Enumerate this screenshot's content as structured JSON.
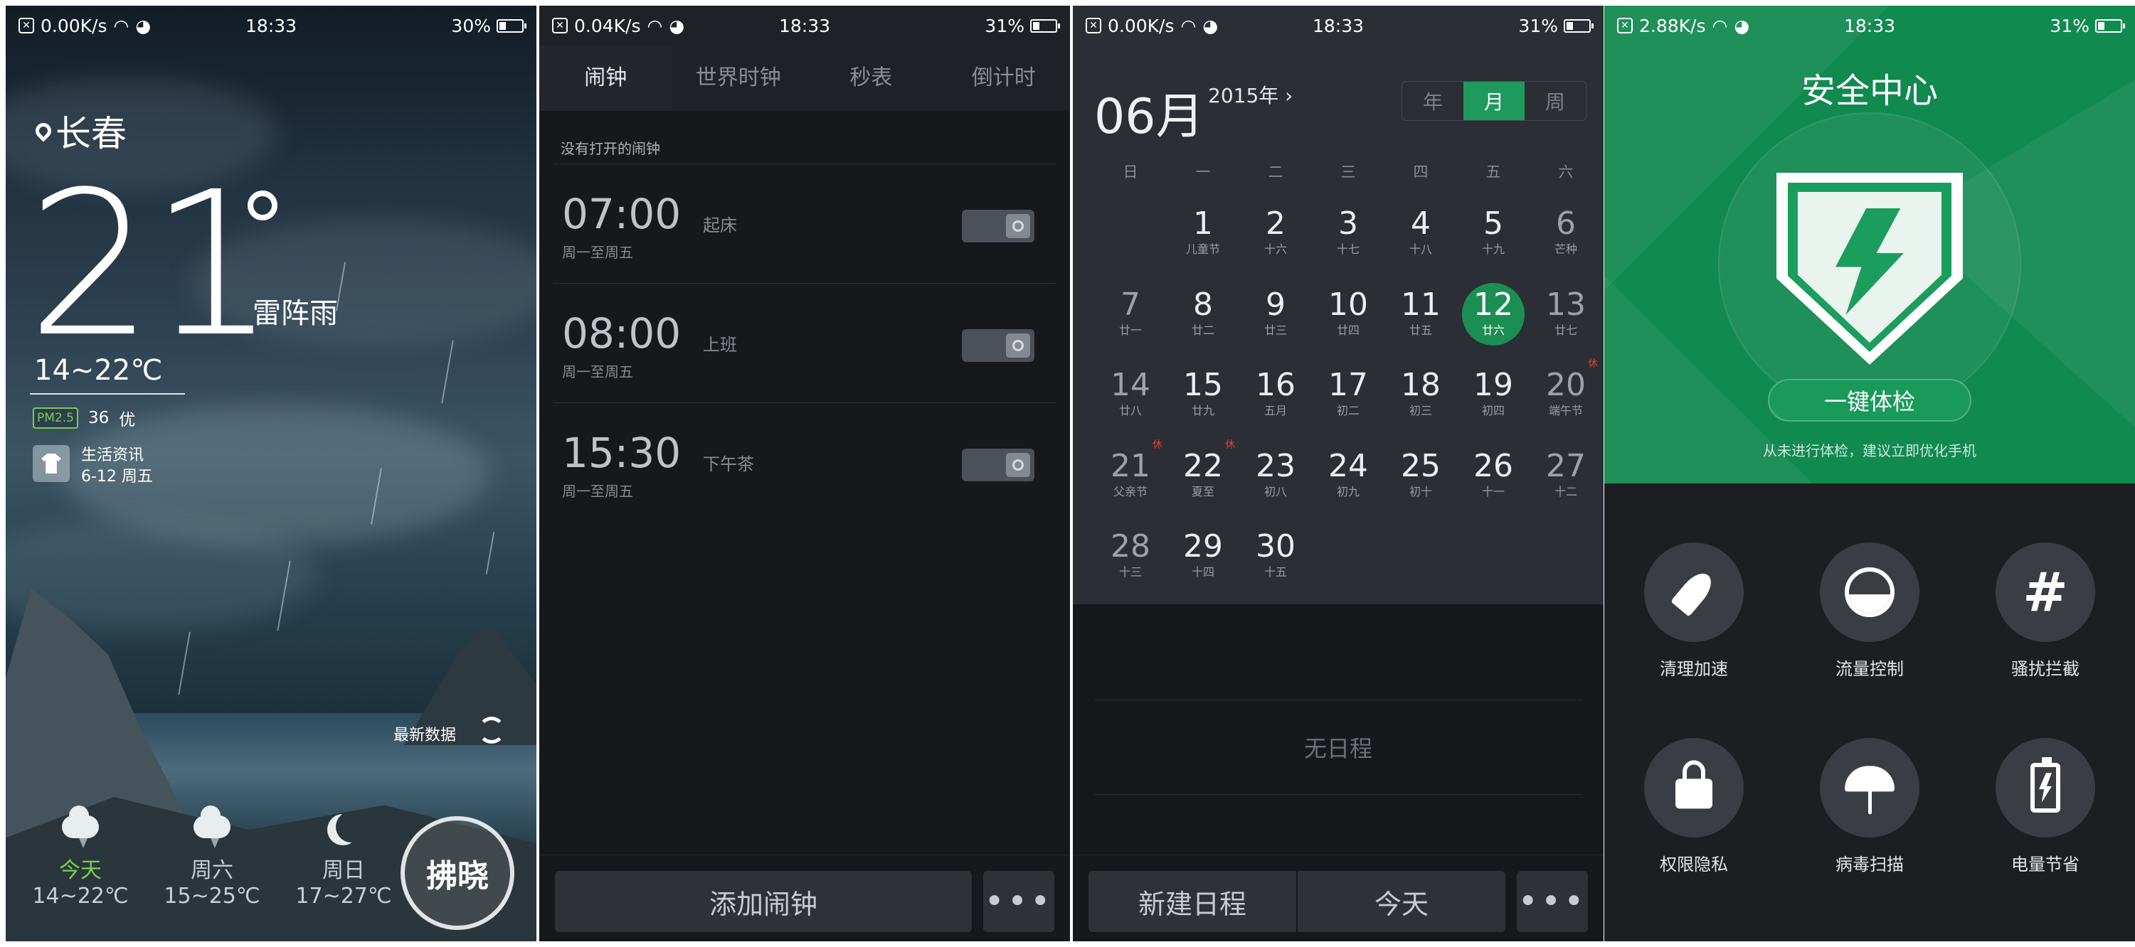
{
  "weather": {
    "status": {
      "speed": "0.00K/s",
      "time": "18:33",
      "battery": "30%",
      "battery_level": 0.3
    },
    "city": "长春",
    "temp": "21",
    "condition": "雷阵雨",
    "range": "14~22℃",
    "pm_label": "PM2.5",
    "pm_value": "36",
    "pm_quality": "优",
    "life_title": "生活资讯",
    "life_date": "6-12 周五",
    "update_label": "最新数据",
    "forecast": [
      {
        "icon": "thunder-cloud-icon",
        "day": "今天",
        "range": "14~22℃"
      },
      {
        "icon": "thunder-cloud-icon",
        "day": "周六",
        "range": "15~25℃"
      },
      {
        "icon": "moon-icon",
        "day": "周日",
        "range": "17~27℃"
      }
    ],
    "watermark": "拂晓"
  },
  "clock": {
    "status": {
      "speed": "0.04K/s",
      "time": "18:33",
      "battery": "31%",
      "battery_level": 0.31
    },
    "tabs": [
      "闹钟",
      "世界时钟",
      "秒表",
      "倒计时"
    ],
    "empty_hint": "没有打开的闹钟",
    "alarms": [
      {
        "time": "07:00",
        "name": "起床",
        "days": "周一至周五",
        "on": false
      },
      {
        "time": "08:00",
        "name": "上班",
        "days": "周一至周五",
        "on": false
      },
      {
        "time": "15:30",
        "name": "下午茶",
        "days": "周一至周五",
        "on": false
      }
    ],
    "add_label": "添加闹钟",
    "more_label": "•••"
  },
  "calendar": {
    "status": {
      "speed": "0.00K/s",
      "time": "18:33",
      "battery": "31%",
      "battery_level": 0.31
    },
    "month": "06月",
    "year": "2015年",
    "views": [
      "年",
      "月",
      "周"
    ],
    "active_view": "月",
    "weekdays": [
      "日",
      "一",
      "二",
      "三",
      "四",
      "五",
      "六"
    ],
    "days": [
      {
        "n": "",
        "l": ""
      },
      {
        "n": "1",
        "l": "儿童节"
      },
      {
        "n": "2",
        "l": "十六"
      },
      {
        "n": "3",
        "l": "十七"
      },
      {
        "n": "4",
        "l": "十八"
      },
      {
        "n": "5",
        "l": "十九"
      },
      {
        "n": "6",
        "l": "芒种"
      },
      {
        "n": "7",
        "l": "廿一"
      },
      {
        "n": "8",
        "l": "廿二"
      },
      {
        "n": "9",
        "l": "廿三"
      },
      {
        "n": "10",
        "l": "廿四"
      },
      {
        "n": "11",
        "l": "廿五"
      },
      {
        "n": "12",
        "l": "廿六",
        "sel": true
      },
      {
        "n": "13",
        "l": "廿七"
      },
      {
        "n": "14",
        "l": "廿八"
      },
      {
        "n": "15",
        "l": "廿九"
      },
      {
        "n": "16",
        "l": "五月"
      },
      {
        "n": "17",
        "l": "初二"
      },
      {
        "n": "18",
        "l": "初三"
      },
      {
        "n": "19",
        "l": "初四"
      },
      {
        "n": "20",
        "l": "端午节",
        "hol": "休"
      },
      {
        "n": "21",
        "l": "父亲节",
        "hol": "休"
      },
      {
        "n": "22",
        "l": "夏至",
        "hol": "休"
      },
      {
        "n": "23",
        "l": "初八"
      },
      {
        "n": "24",
        "l": "初九"
      },
      {
        "n": "25",
        "l": "初十"
      },
      {
        "n": "26",
        "l": "十一"
      },
      {
        "n": "27",
        "l": "十二"
      },
      {
        "n": "28",
        "l": "十三"
      },
      {
        "n": "29",
        "l": "十四"
      },
      {
        "n": "30",
        "l": "十五"
      }
    ],
    "no_event": "无日程",
    "new_label": "新建日程",
    "today_label": "今天",
    "more_label": "•••"
  },
  "security": {
    "status": {
      "speed": "2.88K/s",
      "time": "18:33",
      "battery": "31%",
      "battery_level": 0.31
    },
    "title": "安全中心",
    "check_label": "一键体检",
    "hint": "从未进行体检，建议立即优化手机",
    "tools": [
      {
        "icon": "rocket-icon",
        "label": "清理加速"
      },
      {
        "icon": "data-gauge-icon",
        "label": "流量控制"
      },
      {
        "icon": "block-grid-icon",
        "label": "骚扰拦截"
      },
      {
        "icon": "lock-icon",
        "label": "权限隐私"
      },
      {
        "icon": "umbrella-icon",
        "label": "病毒扫描"
      },
      {
        "icon": "battery-bolt-icon",
        "label": "电量节省"
      }
    ],
    "accent": "#118a50"
  }
}
